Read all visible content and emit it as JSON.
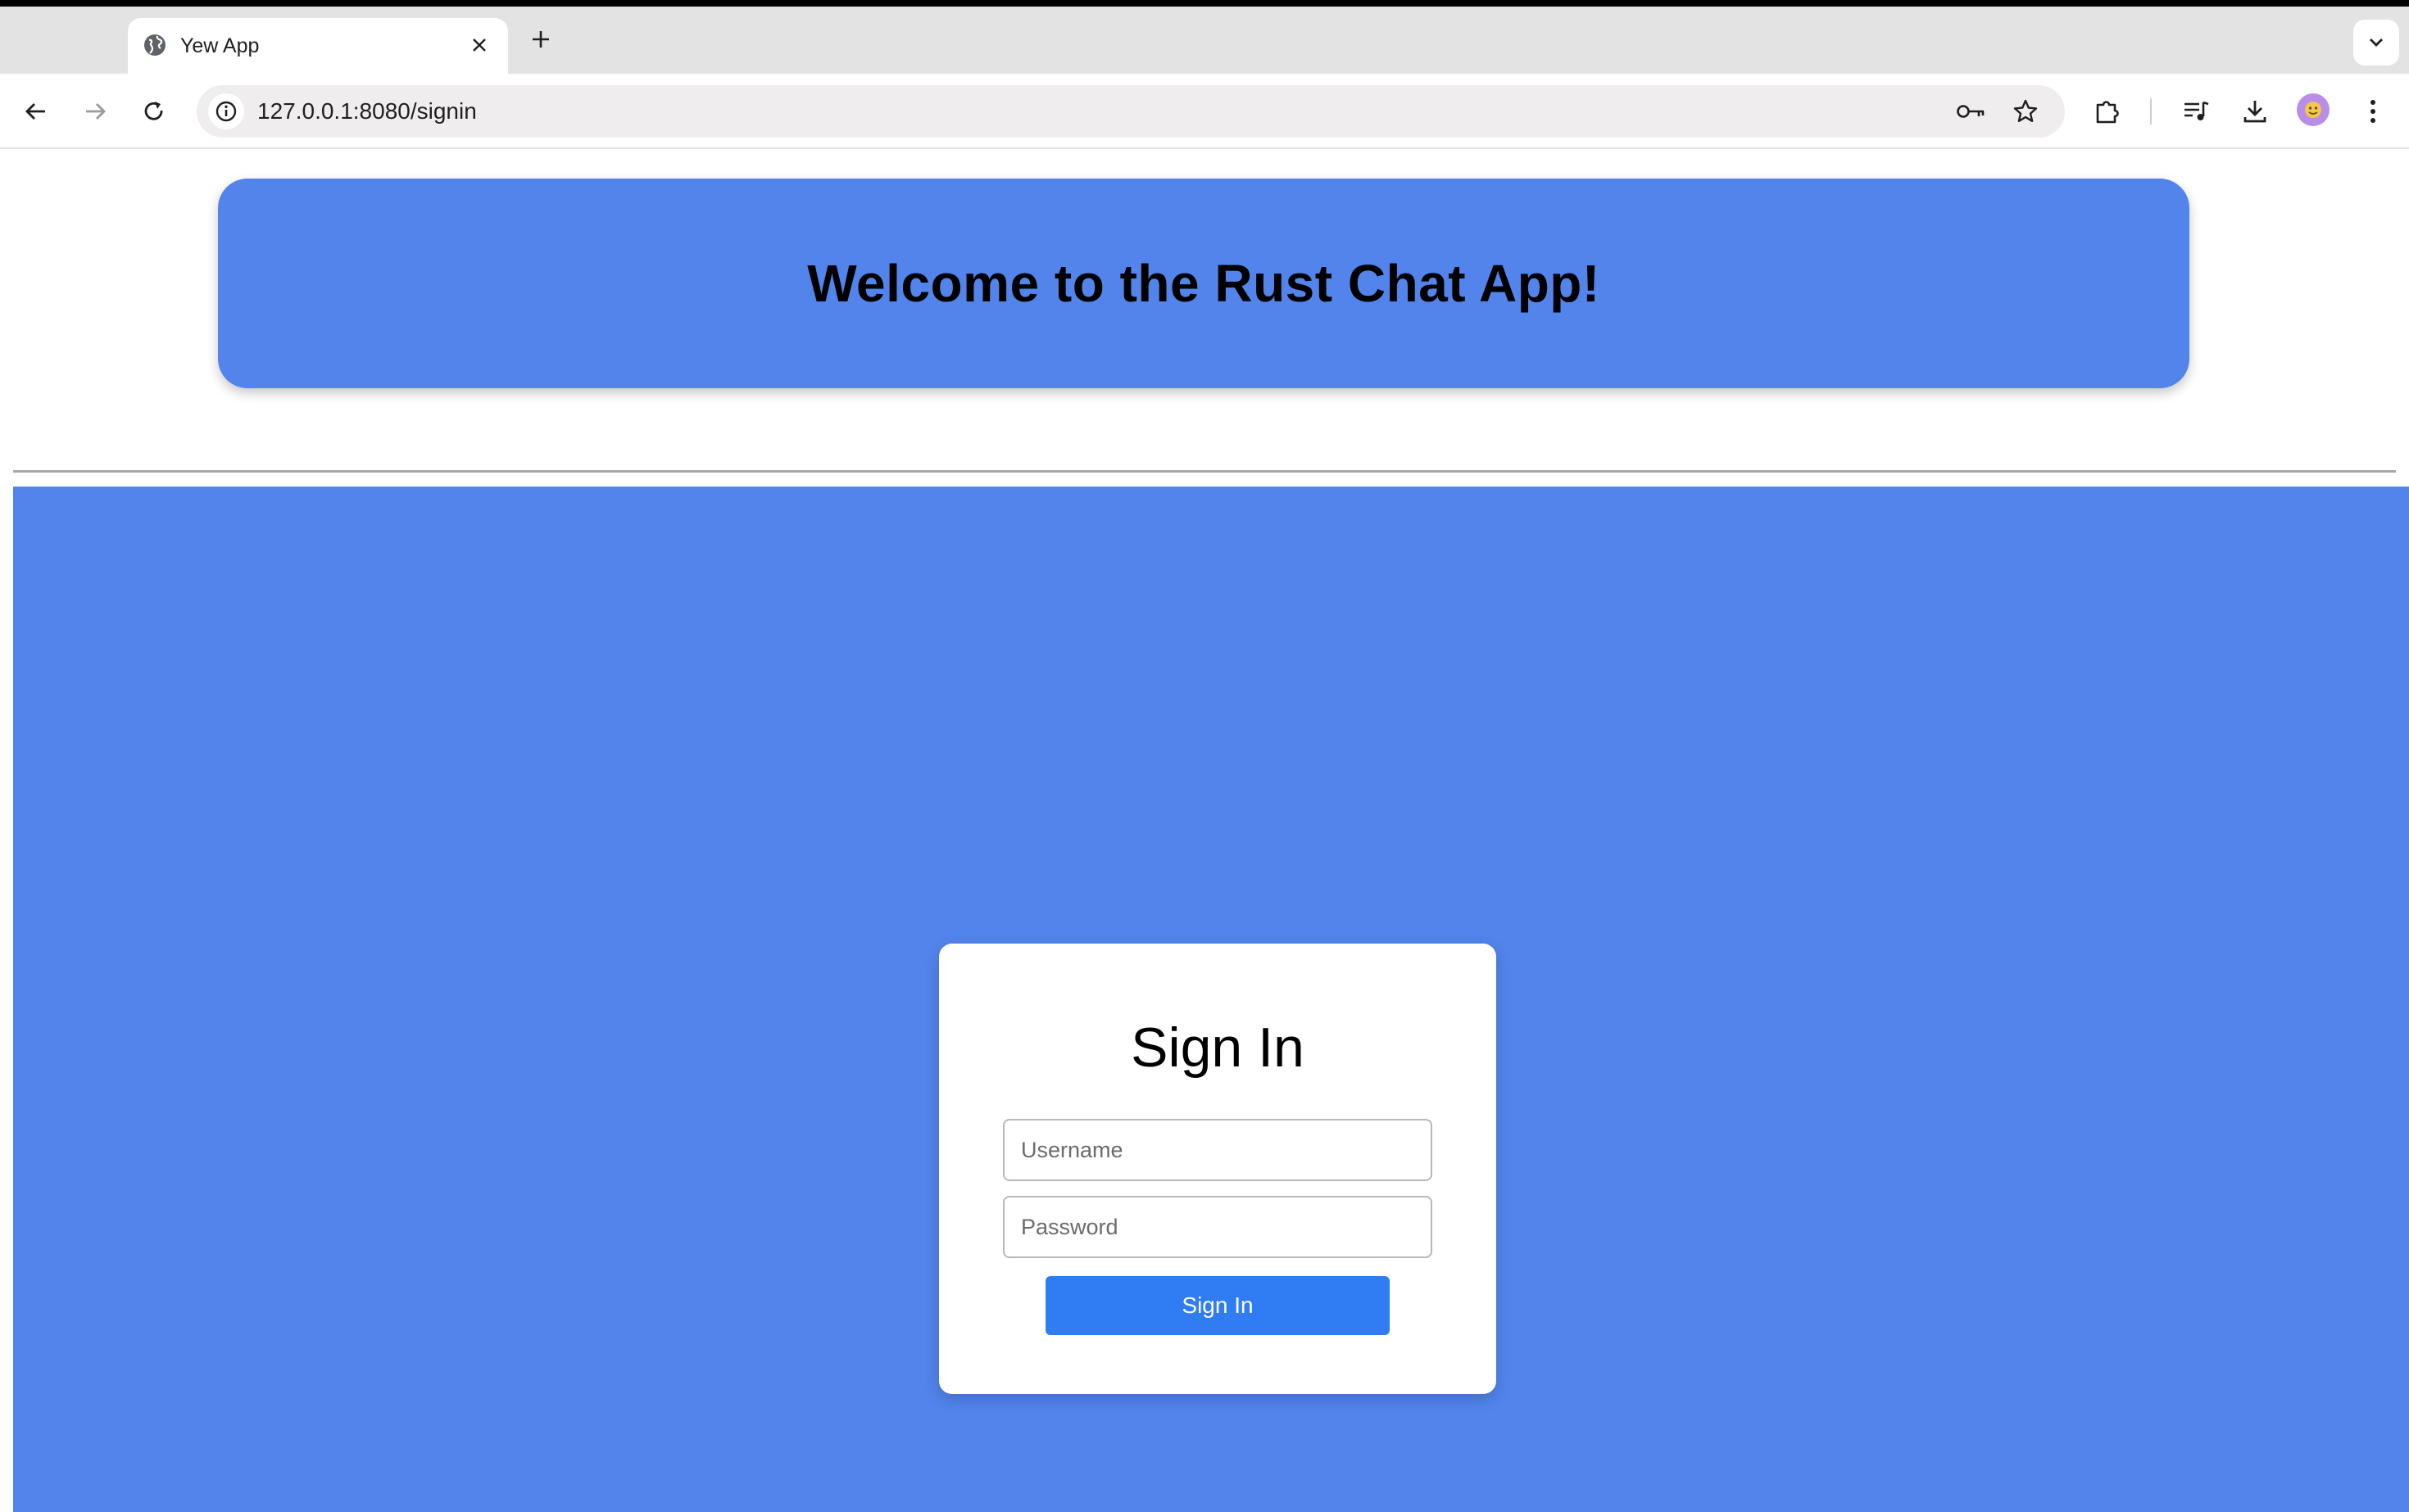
{
  "browser": {
    "tab_title": "Yew App",
    "url": "127.0.0.1:8080/signin",
    "icons": [
      "globe-icon",
      "close-icon",
      "plus-icon",
      "chevron-down-icon",
      "back-arrow-icon",
      "forward-arrow-icon",
      "reload-icon",
      "info-icon",
      "key-icon",
      "star-icon",
      "puzzle-icon",
      "media-icon",
      "download-icon",
      "avatar",
      "kebab-menu-icon"
    ]
  },
  "header": {
    "title": "Welcome to the Rust Chat App!"
  },
  "signin": {
    "title": "Sign In",
    "username_placeholder": "Username",
    "password_placeholder": "Password",
    "submit_label": "Sign In"
  },
  "colors": {
    "accent": "#5284ec",
    "button": "#2f7cf3"
  }
}
